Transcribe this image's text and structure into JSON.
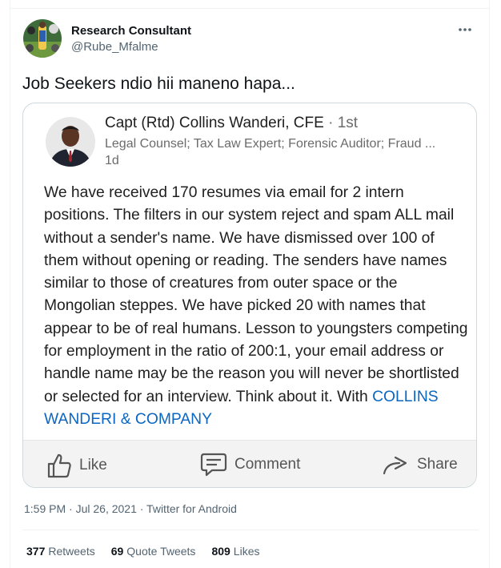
{
  "author": {
    "display_name": "Research Consultant",
    "handle": "@Rube_Mfalme"
  },
  "tweet": {
    "text": "Job Seekers ndio hii maneno hapa..."
  },
  "embedded_post": {
    "author_name": "Capt (Rtd) Collins Wanderi, CFE",
    "degree": " · 1st",
    "subtitle": "Legal Counsel; Tax Law Expert; Forensic Auditor; Fraud ...",
    "age": "1d",
    "body": "We have received 170 resumes via email for 2 intern positions. The filters in our system reject and spam ALL mail without a sender's name. We have dismissed over 100 of them without opening or reading. The senders have names similar to those of creatures from outer space or the Mongolian steppes. We have picked 20 with names that appear to be of real humans. Lesson to youngsters competing for employment in the ratio of 200:1, your email address or handle name may be the reason you will never be shortlisted or selected for an interview. Think about it. With ",
    "company": "COLLINS WANDERI & COMPANY",
    "actions": {
      "like": "Like",
      "comment": "Comment",
      "share": "Share"
    }
  },
  "meta": {
    "timestamp": "1:59 PM · Jul 26, 2021 · Twitter for Android"
  },
  "stats": {
    "retweets_count": "377",
    "retweets_label": "Retweets",
    "quotes_count": "69",
    "quotes_label": "Quote Tweets",
    "likes_count": "809",
    "likes_label": "Likes"
  },
  "colors": {
    "link_blue": "#0a66c2",
    "muted_text": "#536471",
    "card_border": "#cfd9de",
    "footer_bg": "#f3f3f3"
  },
  "icons": [
    "more-icon",
    "like-icon",
    "comment-icon",
    "share-icon"
  ]
}
